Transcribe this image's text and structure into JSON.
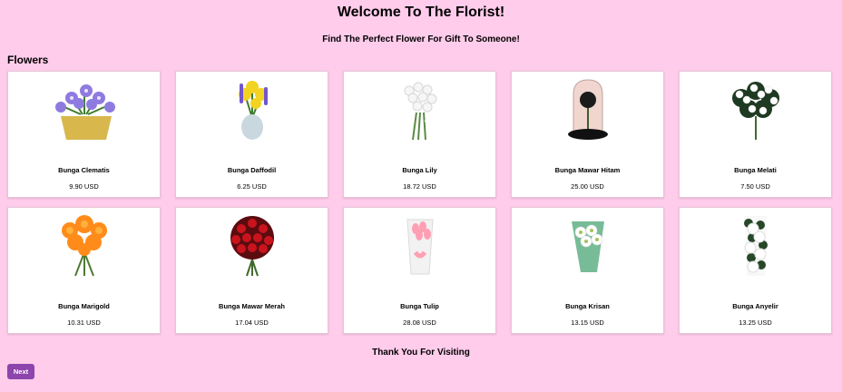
{
  "header": {
    "title": "Welcome To The Florist!",
    "subtitle": "Find The Perfect Flower For Gift To Someone!"
  },
  "section": {
    "title": "Flowers"
  },
  "products": [
    {
      "name": "Bunga Clematis",
      "price": "9.90 USD",
      "image": "clematis"
    },
    {
      "name": "Bunga Daffodil",
      "price": "6.25 USD",
      "image": "daffodil"
    },
    {
      "name": "Bunga Lily",
      "price": "18.72 USD",
      "image": "lily"
    },
    {
      "name": "Bunga Mawar Hitam",
      "price": "25.00 USD",
      "image": "black-rose"
    },
    {
      "name": "Bunga Melati",
      "price": "7.50 USD",
      "image": "jasmine"
    },
    {
      "name": "Bunga Marigold",
      "price": "10.31 USD",
      "image": "marigold"
    },
    {
      "name": "Bunga Mawar Merah",
      "price": "17.04 USD",
      "image": "red-rose"
    },
    {
      "name": "Bunga Tulip",
      "price": "28.08 USD",
      "image": "tulip"
    },
    {
      "name": "Bunga Krisan",
      "price": "13.15 USD",
      "image": "chrysanthemum"
    },
    {
      "name": "Bunga Anyelir",
      "price": "13.25 USD",
      "image": "carnation"
    }
  ],
  "footer": {
    "text": "Thank You For Visiting",
    "next_label": "Next"
  },
  "colors": {
    "background": "#ffcceb",
    "card": "#ffffff",
    "button": "#8e44ad"
  }
}
